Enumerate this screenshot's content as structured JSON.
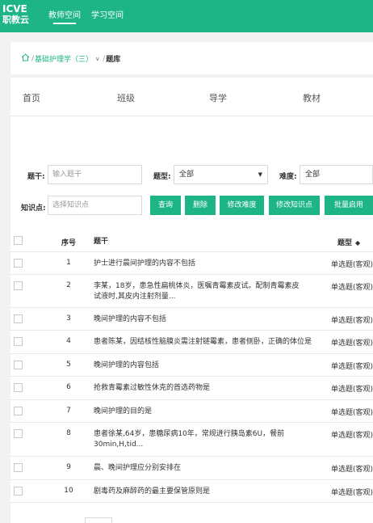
{
  "logo": {
    "line1": "ICVE",
    "line2": "职教云"
  },
  "nav": {
    "teacher": "教师空间",
    "study": "学习空间"
  },
  "breadcrumb": {
    "course": "基础护理学（三）",
    "arrow": "∨",
    "separator": "/",
    "current": "题库"
  },
  "tabs": [
    "首页",
    "班级",
    "导学",
    "教材"
  ],
  "filters": {
    "stem_label": "题干:",
    "stem_placeholder": "输入题干",
    "type_label": "题型:",
    "type_value": "全部",
    "difficulty_label": "难度:",
    "difficulty_value": "全部",
    "knowledge_label": "知识点:",
    "knowledge_placeholder": "选择知识点"
  },
  "buttons": {
    "query": "查询",
    "delete": "删除",
    "edit_difficulty": "修改难度",
    "edit_knowledge": "修改知识点",
    "batch_enable": "批量启用"
  },
  "table": {
    "headers": {
      "index": "序号",
      "stem": "题干",
      "type": "题型"
    },
    "rows": [
      {
        "index": "1",
        "stem": "护士进行晨间护理的内容不包括",
        "type": "单选题(客观)"
      },
      {
        "index": "2",
        "stem": "李某，18岁，患急性扁桃体炎，医嘱青霉素皮试。配制青霉素皮试液时,其皮内注射剂量...",
        "type": "单选题(客观)"
      },
      {
        "index": "3",
        "stem": "晚间护理的内容不包括",
        "type": "单选题(客观)"
      },
      {
        "index": "4",
        "stem": "患者陈某，因结核性脑膜炎需注射链霉素，患者侧卧，正确的体位是",
        "type": "单选题(客观)"
      },
      {
        "index": "5",
        "stem": "晚间护理的内容包括",
        "type": "单选题(客观)"
      },
      {
        "index": "6",
        "stem": "抢救青霉素过敏性休克的首选药物是",
        "type": "单选题(客观)"
      },
      {
        "index": "7",
        "stem": "晚间护理的目的是",
        "type": "单选题(客观)"
      },
      {
        "index": "8",
        "stem": "患者徐某,64岁，患糖尿病10年，常规进行胰岛素6U，餐前30min,H,tid...",
        "type": "单选题(客观)"
      },
      {
        "index": "9",
        "stem": "晨、晚间护理应分别安排在",
        "type": "单选题(客观)"
      },
      {
        "index": "10",
        "stem": "剧毒药及麻醉药的最主要保管原则是",
        "type": "单选题(客观)"
      }
    ]
  },
  "icons": {
    "home": "home-icon",
    "sort": "sort-icon",
    "caret": "caret-down-icon"
  },
  "colors": {
    "brand": "#1db586"
  }
}
